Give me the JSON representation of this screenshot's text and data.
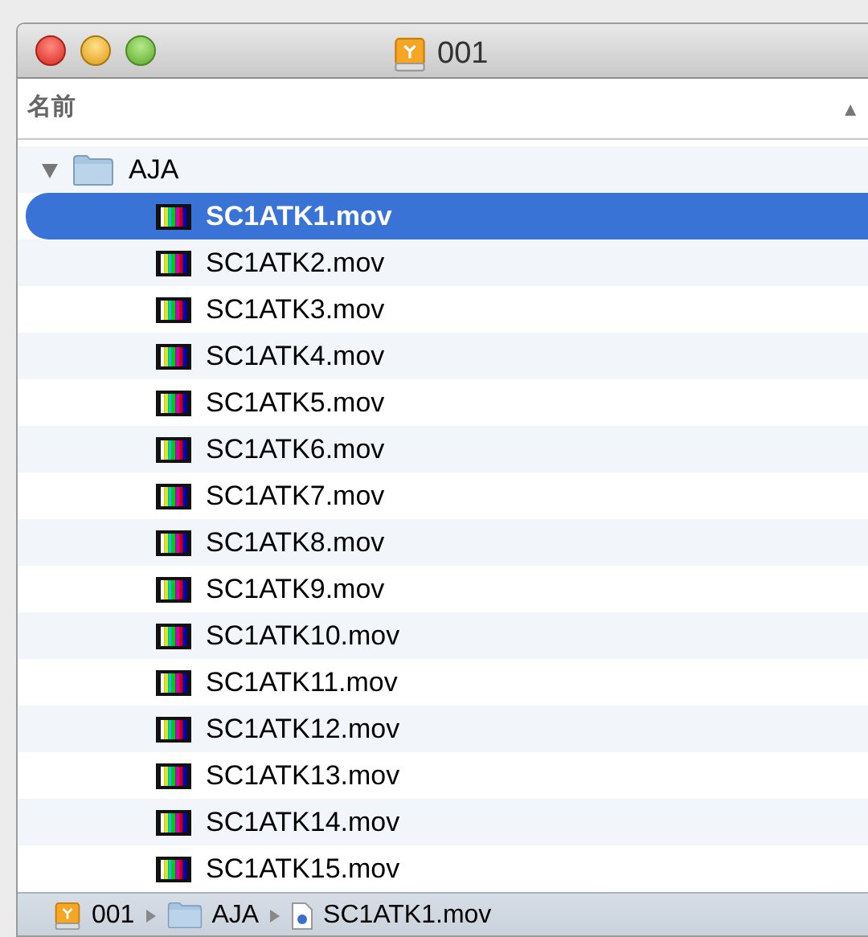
{
  "window": {
    "title": "001"
  },
  "column_header": {
    "label": "名前",
    "sort": "▲"
  },
  "tree": [
    {
      "name": "AJA",
      "kind": "folder",
      "expanded": true,
      "selected": false,
      "children": [
        {
          "name": "SC1ATK1.mov",
          "kind": "movie",
          "selected": true
        },
        {
          "name": "SC1ATK2.mov",
          "kind": "movie",
          "selected": false
        },
        {
          "name": "SC1ATK3.mov",
          "kind": "movie",
          "selected": false
        },
        {
          "name": "SC1ATK4.mov",
          "kind": "movie",
          "selected": false
        },
        {
          "name": "SC1ATK5.mov",
          "kind": "movie",
          "selected": false
        },
        {
          "name": "SC1ATK6.mov",
          "kind": "movie",
          "selected": false
        },
        {
          "name": "SC1ATK7.mov",
          "kind": "movie",
          "selected": false
        },
        {
          "name": "SC1ATK8.mov",
          "kind": "movie",
          "selected": false
        },
        {
          "name": "SC1ATK9.mov",
          "kind": "movie",
          "selected": false
        },
        {
          "name": "SC1ATK10.mov",
          "kind": "movie",
          "selected": false
        },
        {
          "name": "SC1ATK11.mov",
          "kind": "movie",
          "selected": false
        },
        {
          "name": "SC1ATK12.mov",
          "kind": "movie",
          "selected": false
        },
        {
          "name": "SC1ATK13.mov",
          "kind": "movie",
          "selected": false
        },
        {
          "name": "SC1ATK14.mov",
          "kind": "movie",
          "selected": false
        },
        {
          "name": "SC1ATK15.mov",
          "kind": "movie",
          "selected": false
        }
      ]
    }
  ],
  "path_bar": [
    {
      "name": "001",
      "kind": "drive"
    },
    {
      "name": "AJA",
      "kind": "folder"
    },
    {
      "name": "SC1ATK1.mov",
      "kind": "document"
    }
  ]
}
